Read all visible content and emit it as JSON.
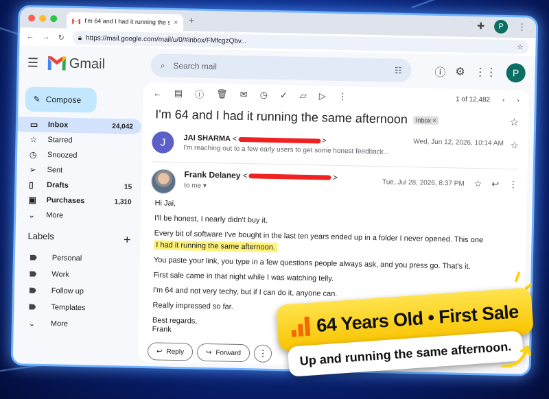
{
  "browser": {
    "tab_title": "I'm 64 and I had it running the s",
    "tab_close": "×",
    "new_tab": "+",
    "url": "https://mail.google.com/mail/u/0/#inbox/FMfcgzQbv...",
    "profile_initial": "P"
  },
  "gmail": {
    "logo_text": "Gmail",
    "search_placeholder": "Search mail",
    "profile_initial": "P"
  },
  "sidebar": {
    "compose_label": "Compose",
    "items": [
      {
        "label": "Inbox",
        "count": "24,042",
        "icon": "inbox-icon"
      },
      {
        "label": "Starred",
        "count": "",
        "icon": "star-icon"
      },
      {
        "label": "Snoozed",
        "count": "",
        "icon": "clock-icon"
      },
      {
        "label": "Sent",
        "count": "",
        "icon": "send-icon"
      },
      {
        "label": "Drafts",
        "count": "15",
        "icon": "draft-icon"
      },
      {
        "label": "Purchases",
        "count": "1,310",
        "icon": "bag-icon"
      },
      {
        "label": "More",
        "count": "",
        "icon": "chevron-down-icon"
      }
    ],
    "labels_heading": "Labels",
    "labels": [
      "Personal",
      "Work",
      "Follow up",
      "Templates",
      "More"
    ]
  },
  "toolbar": {
    "pager_text": "1 of 12,482"
  },
  "thread": {
    "subject": "I'm 64 and I had it running the same afternoon",
    "chip": "Inbox ×",
    "msg1": {
      "avatar": "J",
      "sender": "JAI SHARMA",
      "lt": "<",
      "gt": ">",
      "snippet": "I'm reaching out to a few early users to get some honest feedback...",
      "date": "Wed, Jun 12, 2026, 10:14 AM"
    },
    "msg2": {
      "sender": "Frank Delaney",
      "lt": "<",
      "gt": ">",
      "to": "to me",
      "date": "Tue, Jul 28, 2026, 8:37 PM",
      "greeting": "Hi Jai,",
      "p1": "I'll be honest, I nearly didn't buy it.",
      "p2": "Every bit of software I've bought in the last ten years ended up in a folder I never opened. This one",
      "p2_highlight": "I had it running the same afternoon.",
      "p3": "You paste your link, you type in a few questions people always ask, and you press go. That's it.",
      "p4": "First sale came in that night while I was watching telly.",
      "p5": "I'm 64 and not very techy, but if I can do it, anyone can.",
      "p6": "Really impressed so far.",
      "sign1": "Best regards,",
      "sign2": "Frank"
    },
    "reply_label": "Reply",
    "forward_label": "Forward"
  },
  "banner": {
    "headline": "64 Years Old • First Sale",
    "subline": "Up and running the same afternoon."
  },
  "colors": {
    "accent": "#0b57d0",
    "highlight": "#fff27a",
    "banner_yellow": "#ffd400"
  }
}
